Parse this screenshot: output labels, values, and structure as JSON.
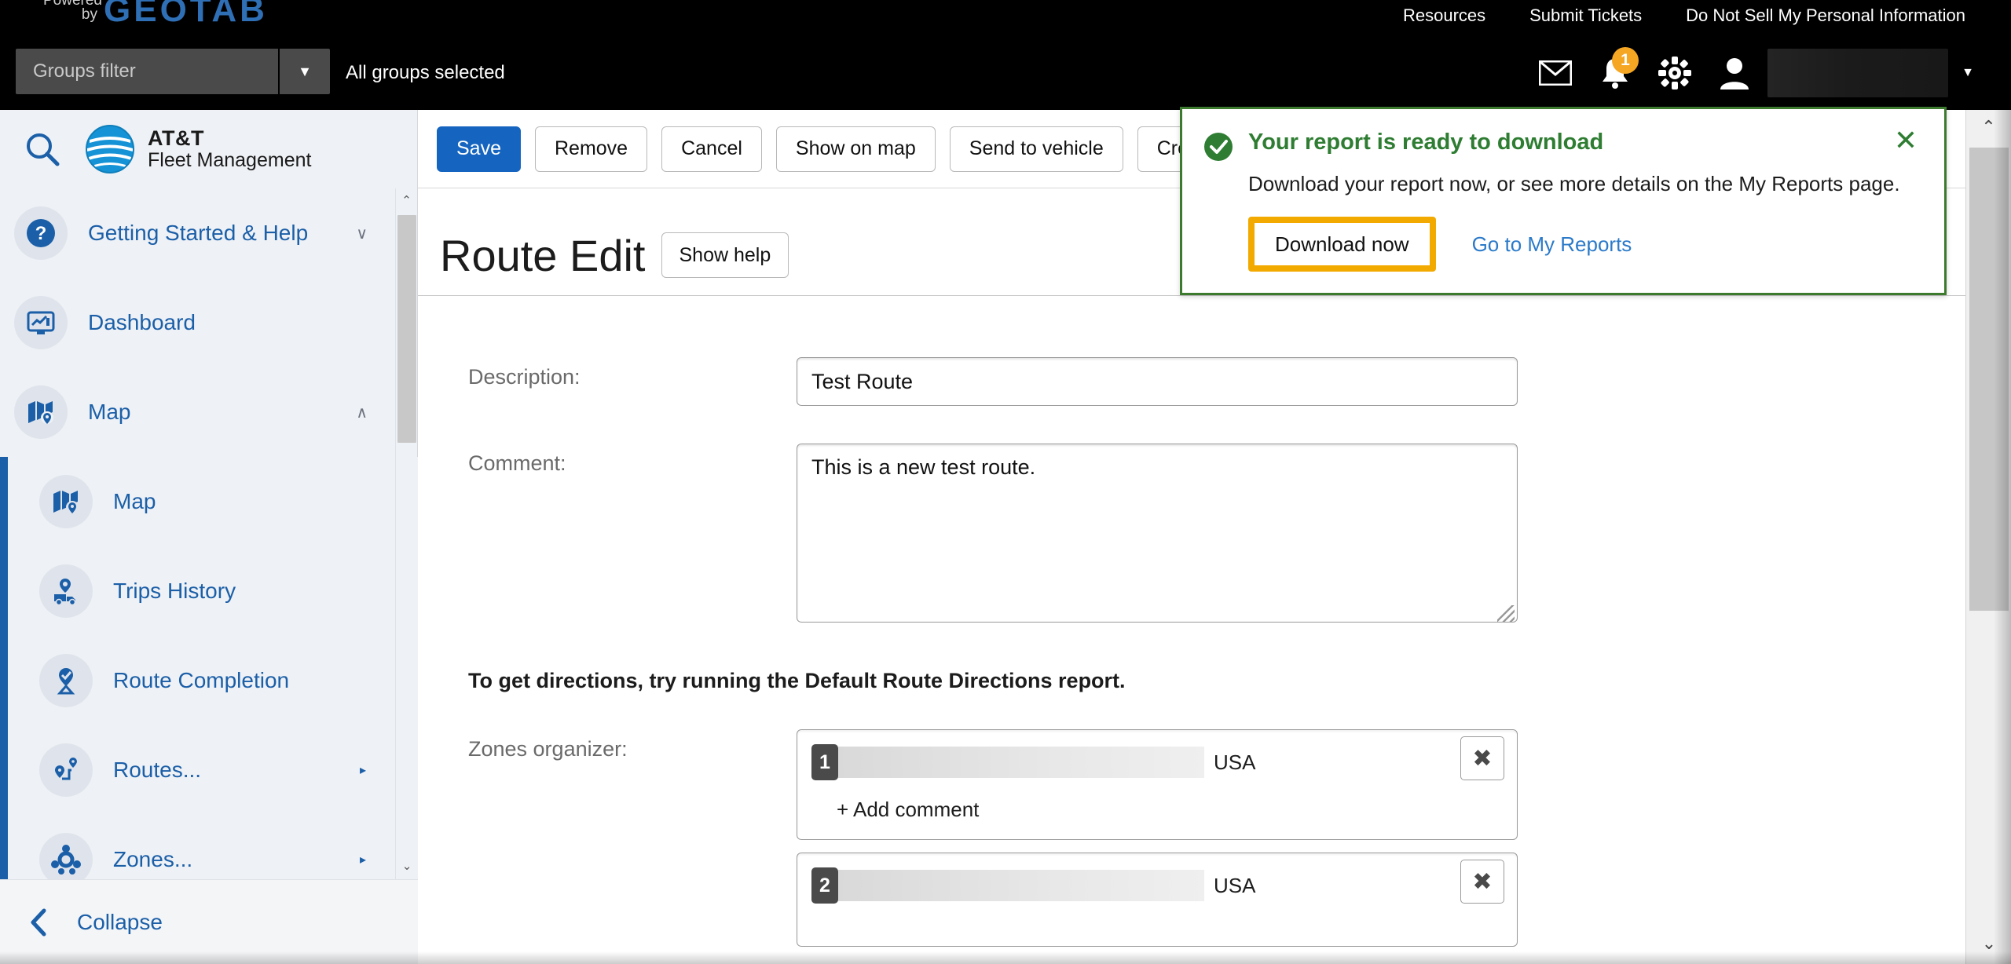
{
  "topbar": {
    "powered_line1": "Powered",
    "powered_line2": "by",
    "brand": "GEOTAB",
    "links": [
      {
        "label": "Resources"
      },
      {
        "label": "Submit Tickets"
      },
      {
        "label": "Do Not Sell My Personal Information"
      }
    ],
    "groups_filter_placeholder": "Groups filter",
    "groups_selected_text": "All groups selected",
    "notification_count": "1"
  },
  "sidebar": {
    "brand_line1": "AT&T",
    "brand_line2": "Fleet Management",
    "items": [
      {
        "label": "Getting Started & Help",
        "chevron": "∨"
      },
      {
        "label": "Dashboard",
        "chevron": ""
      },
      {
        "label": "Map",
        "chevron": "∧"
      }
    ],
    "sub_items": [
      {
        "label": "Map",
        "arrow": ""
      },
      {
        "label": "Trips History",
        "arrow": ""
      },
      {
        "label": "Route Completion",
        "arrow": ""
      },
      {
        "label": "Routes...",
        "arrow": "▸"
      },
      {
        "label": "Zones...",
        "arrow": "▸"
      }
    ],
    "collapse_label": "Collapse"
  },
  "toolbar": {
    "buttons": [
      {
        "label": "Save",
        "primary": true
      },
      {
        "label": "Remove",
        "primary": false
      },
      {
        "label": "Cancel",
        "primary": false
      },
      {
        "label": "Show on map",
        "primary": false
      },
      {
        "label": "Send to vehicle",
        "primary": false
      },
      {
        "label": "Create plan",
        "primary": false
      }
    ]
  },
  "page": {
    "title": "Route Edit",
    "help_button": "Show help",
    "description_label": "Description:",
    "description_value": "Test Route",
    "comment_label": "Comment:",
    "comment_value": "This is a new test route.",
    "directions_hint": "To get directions, try running the Default Route Directions report.",
    "zones_label": "Zones organizer:",
    "zones": [
      {
        "number": "1",
        "country": "USA",
        "add_comment": "+ Add comment",
        "remove": "✖"
      },
      {
        "number": "2",
        "country": "USA",
        "add_comment": "",
        "remove": "✖"
      }
    ]
  },
  "toast": {
    "title": "Your report is ready to download",
    "body": "Download your report now, or see more details on the My Reports page.",
    "primary_button": "Download now",
    "link": "Go to My Reports",
    "close": "✕",
    "border_color": "#3c7a2e",
    "title_color": "#2e7d32",
    "focus_color": "#F2A900"
  },
  "colors": {
    "accent_blue": "#1b5fa8",
    "primary_button": "#1565c0",
    "badge_orange": "#F5A623",
    "geotab_blue": "#2f6fb5"
  },
  "scrollbars": {
    "up_arrow": "⌃",
    "down_arrow": "⌄"
  }
}
